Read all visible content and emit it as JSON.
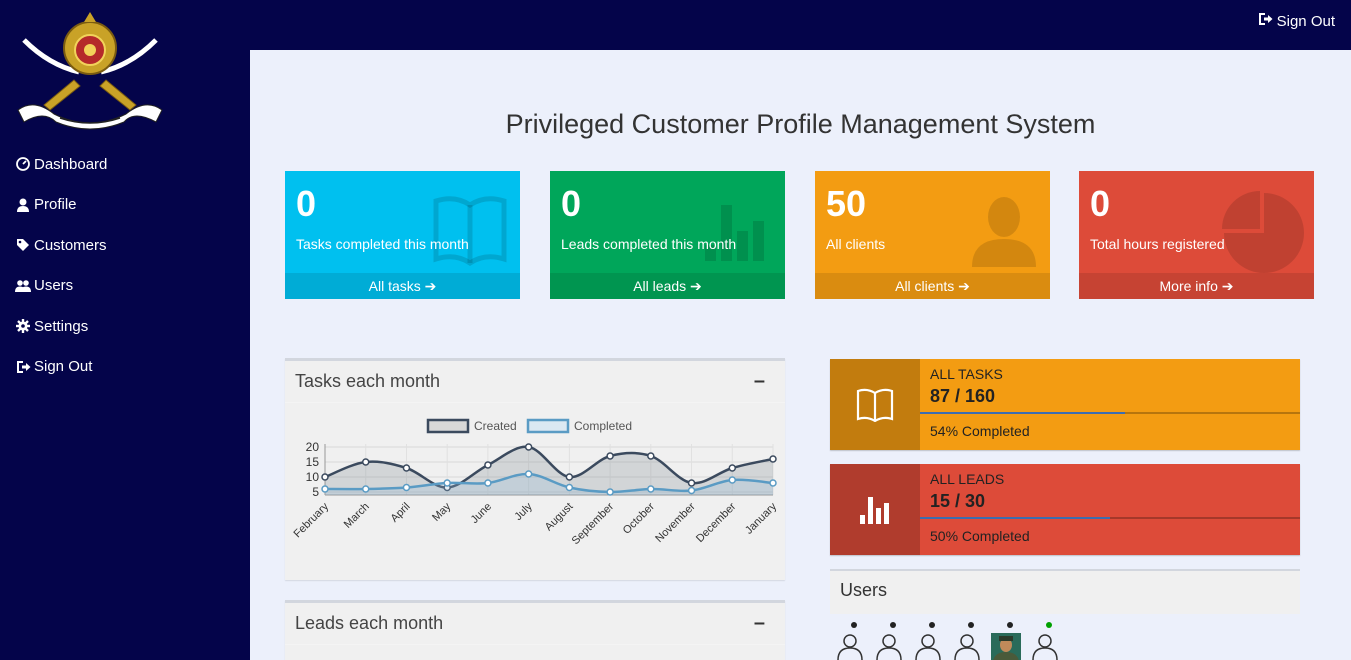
{
  "topbar": {
    "signout_label": "Sign Out"
  },
  "sidebar": {
    "items": [
      {
        "label": "Dashboard",
        "icon": "dashboard-icon"
      },
      {
        "label": "Profile",
        "icon": "user-icon"
      },
      {
        "label": "Customers",
        "icon": "tag-icon"
      },
      {
        "label": "Users",
        "icon": "users-icon"
      },
      {
        "label": "Settings",
        "icon": "gear-icon"
      },
      {
        "label": "Sign Out",
        "icon": "sign-out-icon"
      }
    ]
  },
  "page": {
    "title": "Privileged Customer Profile Management System"
  },
  "stats": [
    {
      "value": "0",
      "label": "Tasks completed this month",
      "footer": "All tasks",
      "icon": "book-icon",
      "color": "#00c0ef"
    },
    {
      "value": "0",
      "label": "Leads completed this month",
      "footer": "All leads",
      "icon": "bar-chart-icon",
      "color": "#00a65a"
    },
    {
      "value": "50",
      "label": "All clients",
      "footer": "All clients",
      "icon": "person-icon",
      "color": "#f39c12"
    },
    {
      "value": "0",
      "label": "Total hours registered",
      "footer": "More info",
      "icon": "pie-chart-icon",
      "color": "#dd4b39"
    }
  ],
  "tasks_chart": {
    "title": "Tasks each month",
    "legend": [
      "Created",
      "Completed"
    ]
  },
  "leads_chart": {
    "title": "Leads each month"
  },
  "chart_data": {
    "type": "line",
    "categories": [
      "February",
      "March",
      "April",
      "May",
      "June",
      "July",
      "August",
      "September",
      "October",
      "November",
      "December",
      "January"
    ],
    "series": [
      {
        "name": "Created",
        "values": [
          10,
          15,
          13,
          6.5,
          14,
          20,
          10,
          17,
          17,
          8,
          13,
          16
        ],
        "color": "#3b4a5e"
      },
      {
        "name": "Completed",
        "values": [
          6,
          6,
          6.5,
          8,
          8,
          11,
          6.5,
          5,
          6,
          5.5,
          9,
          8
        ],
        "color": "#5a9bc4"
      }
    ],
    "yticks": [
      5,
      10,
      15,
      20
    ],
    "ylim": [
      4,
      21
    ],
    "grid": true,
    "legend_position": "top"
  },
  "progress": [
    {
      "title": "ALL TASKS",
      "numbers": "87 / 160",
      "desc": "54% Completed",
      "fraction": 0.54,
      "icon": "book-icon",
      "color": "#f39c12"
    },
    {
      "title": "ALL LEADS",
      "numbers": "15 / 30",
      "desc": "50% Completed",
      "fraction": 0.5,
      "icon": "bar-chart-icon",
      "color": "#dd4b39"
    }
  ],
  "users_panel": {
    "title": "Users",
    "users": [
      {
        "status": "offline",
        "status_color": "#222222",
        "avatar": "person-outline-icon"
      },
      {
        "status": "offline",
        "status_color": "#222222",
        "avatar": "person-outline-icon"
      },
      {
        "status": "offline",
        "status_color": "#222222",
        "avatar": "person-outline-icon"
      },
      {
        "status": "offline",
        "status_color": "#222222",
        "avatar": "person-outline-icon"
      },
      {
        "status": "offline",
        "status_color": "#222222",
        "avatar": "photo-avatar"
      },
      {
        "status": "online",
        "status_color": "#00a000",
        "avatar": "person-outline-icon"
      }
    ]
  }
}
